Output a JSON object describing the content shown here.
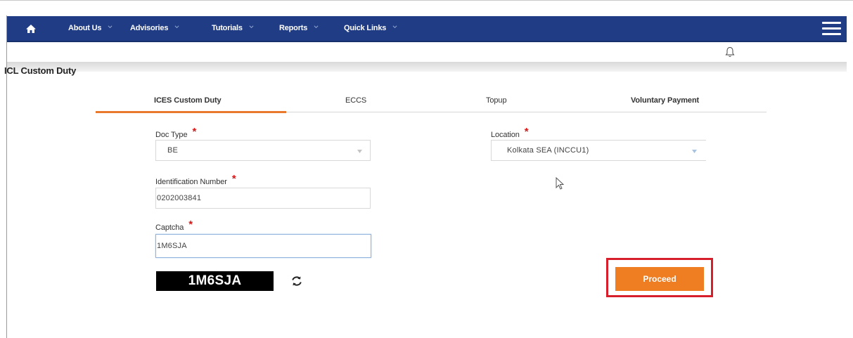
{
  "nav": {
    "items": [
      {
        "label": "About Us"
      },
      {
        "label": "Advisories"
      },
      {
        "label": "Tutorials"
      },
      {
        "label": "Reports"
      },
      {
        "label": "Quick Links"
      }
    ],
    "home_icon": "home-icon",
    "menu_icon": "hamburger-menu-icon",
    "bell_icon": "bell-icon",
    "background": "#1f3c84"
  },
  "page": {
    "title": "ICL Custom Duty"
  },
  "tabs": [
    {
      "label": "ICES Custom Duty",
      "active": true
    },
    {
      "label": "ECCS",
      "active": false
    },
    {
      "label": "Topup",
      "active": false
    },
    {
      "label": "Voluntary Payment",
      "active": false
    }
  ],
  "form": {
    "doc_type": {
      "label": "Doc Type",
      "required_mark": "*",
      "value": "BE"
    },
    "location": {
      "label": "Location",
      "required_mark": "*",
      "value": "Kolkata SEA (INCCU1)"
    },
    "identification_number": {
      "label": "Identification Number",
      "required_mark": "*",
      "value": "0202003841"
    },
    "captcha": {
      "label": "Captcha",
      "required_mark": "*",
      "value": "1M6SJA"
    },
    "captcha_image_text": "1M6SJA",
    "refresh_icon": "refresh-icon"
  },
  "actions": {
    "proceed_label": "Proceed"
  },
  "colors": {
    "accent": "#ef7d22",
    "tab_underline": "#e8792d",
    "required": "#d21919",
    "highlight": "#d71f2b"
  }
}
